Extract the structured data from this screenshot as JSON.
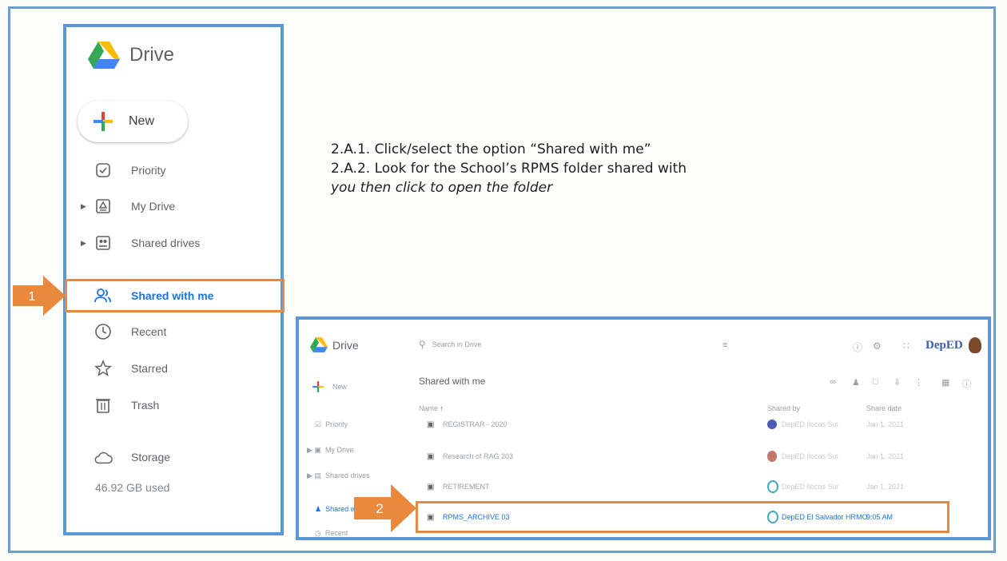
{
  "sidebar": {
    "logo_text": "Drive",
    "new_label": "New",
    "items": [
      {
        "label": "Priority",
        "icon": "priority-icon",
        "expandable": false
      },
      {
        "label": "My Drive",
        "icon": "my-drive-icon",
        "expandable": true
      },
      {
        "label": "Shared drives",
        "icon": "shared-drives-icon",
        "expandable": true
      },
      {
        "label": "Shared with me",
        "icon": "shared-with-me-icon",
        "expandable": false,
        "active": true
      },
      {
        "label": "Recent",
        "icon": "clock-icon",
        "expandable": false
      },
      {
        "label": "Starred",
        "icon": "star-icon",
        "expandable": false
      },
      {
        "label": "Trash",
        "icon": "trash-icon",
        "expandable": false
      },
      {
        "label": "Storage",
        "icon": "cloud-icon",
        "expandable": false
      }
    ],
    "storage_used": "46.92 GB used"
  },
  "callouts": {
    "step1": "1",
    "step2": "2"
  },
  "instructions": {
    "line1": "2.A.1. Click/select the option “Shared with me”",
    "line2": "2.A.2. Look for the School’s RPMS folder shared with",
    "line3": "you then click to open the folder"
  },
  "inner": {
    "logo_text": "Drive",
    "search_placeholder": "Search in Drive",
    "brand": "DepED",
    "section_title": "Shared with me",
    "new_label": "New",
    "columns": {
      "name": "Name",
      "shared_by": "Shared by",
      "share_date": "Share date"
    },
    "nav": [
      "Priority",
      "My Drive",
      "Shared drives",
      "Shared wi",
      "Recent"
    ],
    "rows": [
      {
        "name": "REGISTRAR - 2020",
        "shared_by": "DepED Ilocos Sur",
        "date": "Jan 1, 2021"
      },
      {
        "name": "Research of RAG 203",
        "shared_by": "DepED Ilocos Sur",
        "date": "Jan 1, 2021"
      },
      {
        "name": "RETIREMENT",
        "shared_by": "DepED Ilocos Sur",
        "date": "Jan 1, 2021"
      },
      {
        "name": "RPMS_ARCHIVE 03",
        "shared_by": "DepED El Salvador HRMO",
        "date": "9:05 AM"
      }
    ]
  },
  "colors": {
    "accent": "#1a73e8",
    "highlight": "#e8893d",
    "frame": "#5b97d4"
  }
}
